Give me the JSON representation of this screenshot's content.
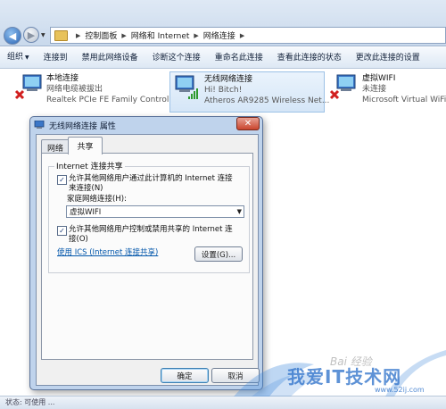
{
  "address": {
    "segments": [
      "控制面板",
      "网络和 Internet",
      "网络连接"
    ]
  },
  "toolbar": {
    "organize": "组织",
    "items": [
      "连接到",
      "禁用此网络设备",
      "诊断这个连接",
      "重命名此连接",
      "查看此连接的状态",
      "更改此连接的设置"
    ]
  },
  "adapters": [
    {
      "name": "本地连接",
      "status": "网络电缆被拔出",
      "device": "Realtek PCIe FE Family Control..."
    },
    {
      "name": "无线网络连接",
      "status": "Hi! Bitch!",
      "device": "Atheros AR9285 Wireless Net..."
    },
    {
      "name": "虚拟WIFI",
      "status": "未连接",
      "device": "Microsoft Virtual WiFi Mi..."
    }
  ],
  "dialog": {
    "title": "无线网络连接 属性",
    "tabs": [
      "网络",
      "共享"
    ],
    "group_title": "Internet 连接共享",
    "allow_share_line1": "允许其他网络用户通过此计算机的 Internet 连接",
    "allow_share_line2": "来连接(N)",
    "allow_share_checked": true,
    "home_conn_label": "家庭网络连接(H):",
    "home_conn_value": "虚拟WIFI",
    "allow_control_line1": "允许其他网络用户控制或禁用共享的 Internet 连",
    "allow_control_line2": "接(O)",
    "allow_control_checked": true,
    "ics_link": "使用 ICS (Internet 连接共享)",
    "settings_label": "设置(G)...",
    "ok_label": "确定",
    "cancel_label": "取消"
  },
  "bottom_text": "状态: 可使用 ...",
  "watermark": {
    "site": "我爱IT技术网",
    "url": "www.52ij.com",
    "baidu": "Bai 经验"
  },
  "colors": {
    "accent": "#2a64b4",
    "link": "#0055aa",
    "error": "#d11f1f"
  }
}
